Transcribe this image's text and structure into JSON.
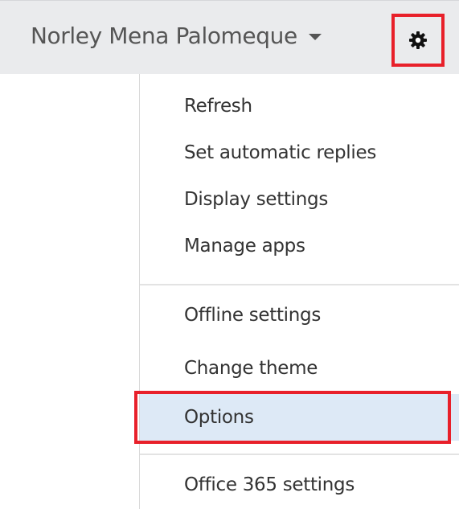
{
  "header": {
    "user_name": "Norley Mena Palomeque",
    "settings_icon": "gear-icon",
    "accent_red": "#e8202a"
  },
  "menu": {
    "groups": [
      {
        "items": [
          {
            "label": "Refresh"
          },
          {
            "label": "Set automatic replies"
          },
          {
            "label": "Display settings"
          },
          {
            "label": "Manage apps"
          }
        ]
      },
      {
        "items": [
          {
            "label": "Offline settings"
          },
          {
            "label": "Change theme"
          },
          {
            "label": "Options",
            "selected": true
          }
        ]
      },
      {
        "items": [
          {
            "label": "Office 365 settings"
          }
        ]
      }
    ],
    "selected_bg": "#dde9f6"
  }
}
